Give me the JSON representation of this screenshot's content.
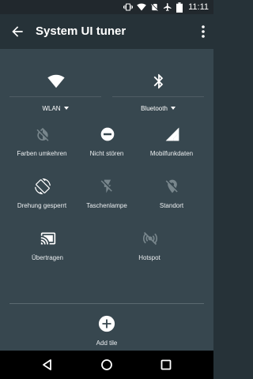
{
  "status_bar": {
    "time": "11:11",
    "icons": [
      "vibrate-icon",
      "wifi-icon",
      "no-sim-icon",
      "airplane-icon",
      "battery-icon"
    ]
  },
  "app_bar": {
    "title": "System UI tuner",
    "back_icon": "arrow-back-icon",
    "menu_icon": "more-vert-icon"
  },
  "quick_settings": {
    "big_tiles": [
      {
        "label": "WLAN",
        "icon": "wifi-icon",
        "has_dropdown": true
      },
      {
        "label": "Bluetooth",
        "icon": "bluetooth-icon",
        "has_dropdown": true
      }
    ],
    "tiles": [
      {
        "label": "Farben umkehren",
        "icon": "invert-colors-off-icon",
        "active": false
      },
      {
        "label": "Nicht stören",
        "icon": "do-not-disturb-icon",
        "active": true
      },
      {
        "label": "Mobilfunkdaten",
        "icon": "cellular-signal-icon",
        "active": true
      },
      {
        "label": "Drehung gesperrt",
        "icon": "screen-rotation-icon",
        "active": true
      },
      {
        "label": "Taschenlampe",
        "icon": "flashlight-off-icon",
        "active": false
      },
      {
        "label": "Standort",
        "icon": "location-off-icon",
        "active": false
      },
      {
        "label": "Übertragen",
        "icon": "cast-icon",
        "active": true
      },
      {
        "label": "Hotspot",
        "icon": "hotspot-off-icon",
        "active": false
      }
    ],
    "add_tile_label": "Add tile"
  },
  "nav_bar": {
    "buttons": [
      "back-triangle-icon",
      "home-circle-icon",
      "recents-square-icon"
    ]
  },
  "colors": {
    "status_bar": "#21282d",
    "app_bar": "#263238",
    "panel": "#37474f",
    "active_icon": "#ffffff",
    "inactive_icon": "#78868c"
  }
}
